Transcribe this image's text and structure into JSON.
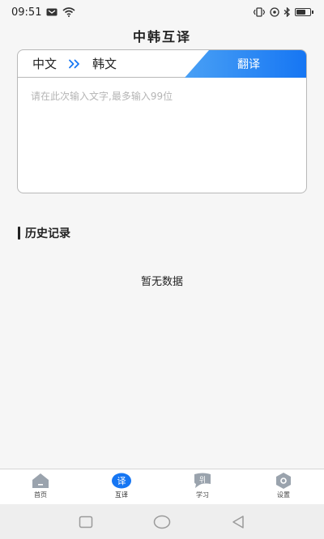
{
  "status_bar": {
    "time": "09:51",
    "left_icons": [
      "message-icon",
      "wifi-icon"
    ],
    "right_icons": [
      "vibrate-icon",
      "nfc-icon",
      "bluetooth-icon",
      "battery-icon"
    ]
  },
  "header": {
    "title": "中韩互译"
  },
  "translator": {
    "source_lang": "中文",
    "target_lang": "韩文",
    "translate_button": "翻译",
    "input_placeholder": "请在此次输入文字,最多输入99位",
    "input_value": "",
    "accent_color": "#1676f3"
  },
  "history": {
    "title": "历史记录",
    "empty_text": "暂无数据"
  },
  "bottom_nav": {
    "items": [
      {
        "label": "首页",
        "icon": "home-icon",
        "active": false
      },
      {
        "label": "互译",
        "icon": "translate-icon",
        "active": true
      },
      {
        "label": "学习",
        "icon": "study-icon",
        "active": false
      },
      {
        "label": "设置",
        "icon": "settings-icon",
        "active": false
      }
    ],
    "translate_glyph": "译",
    "study_glyph": "위"
  }
}
